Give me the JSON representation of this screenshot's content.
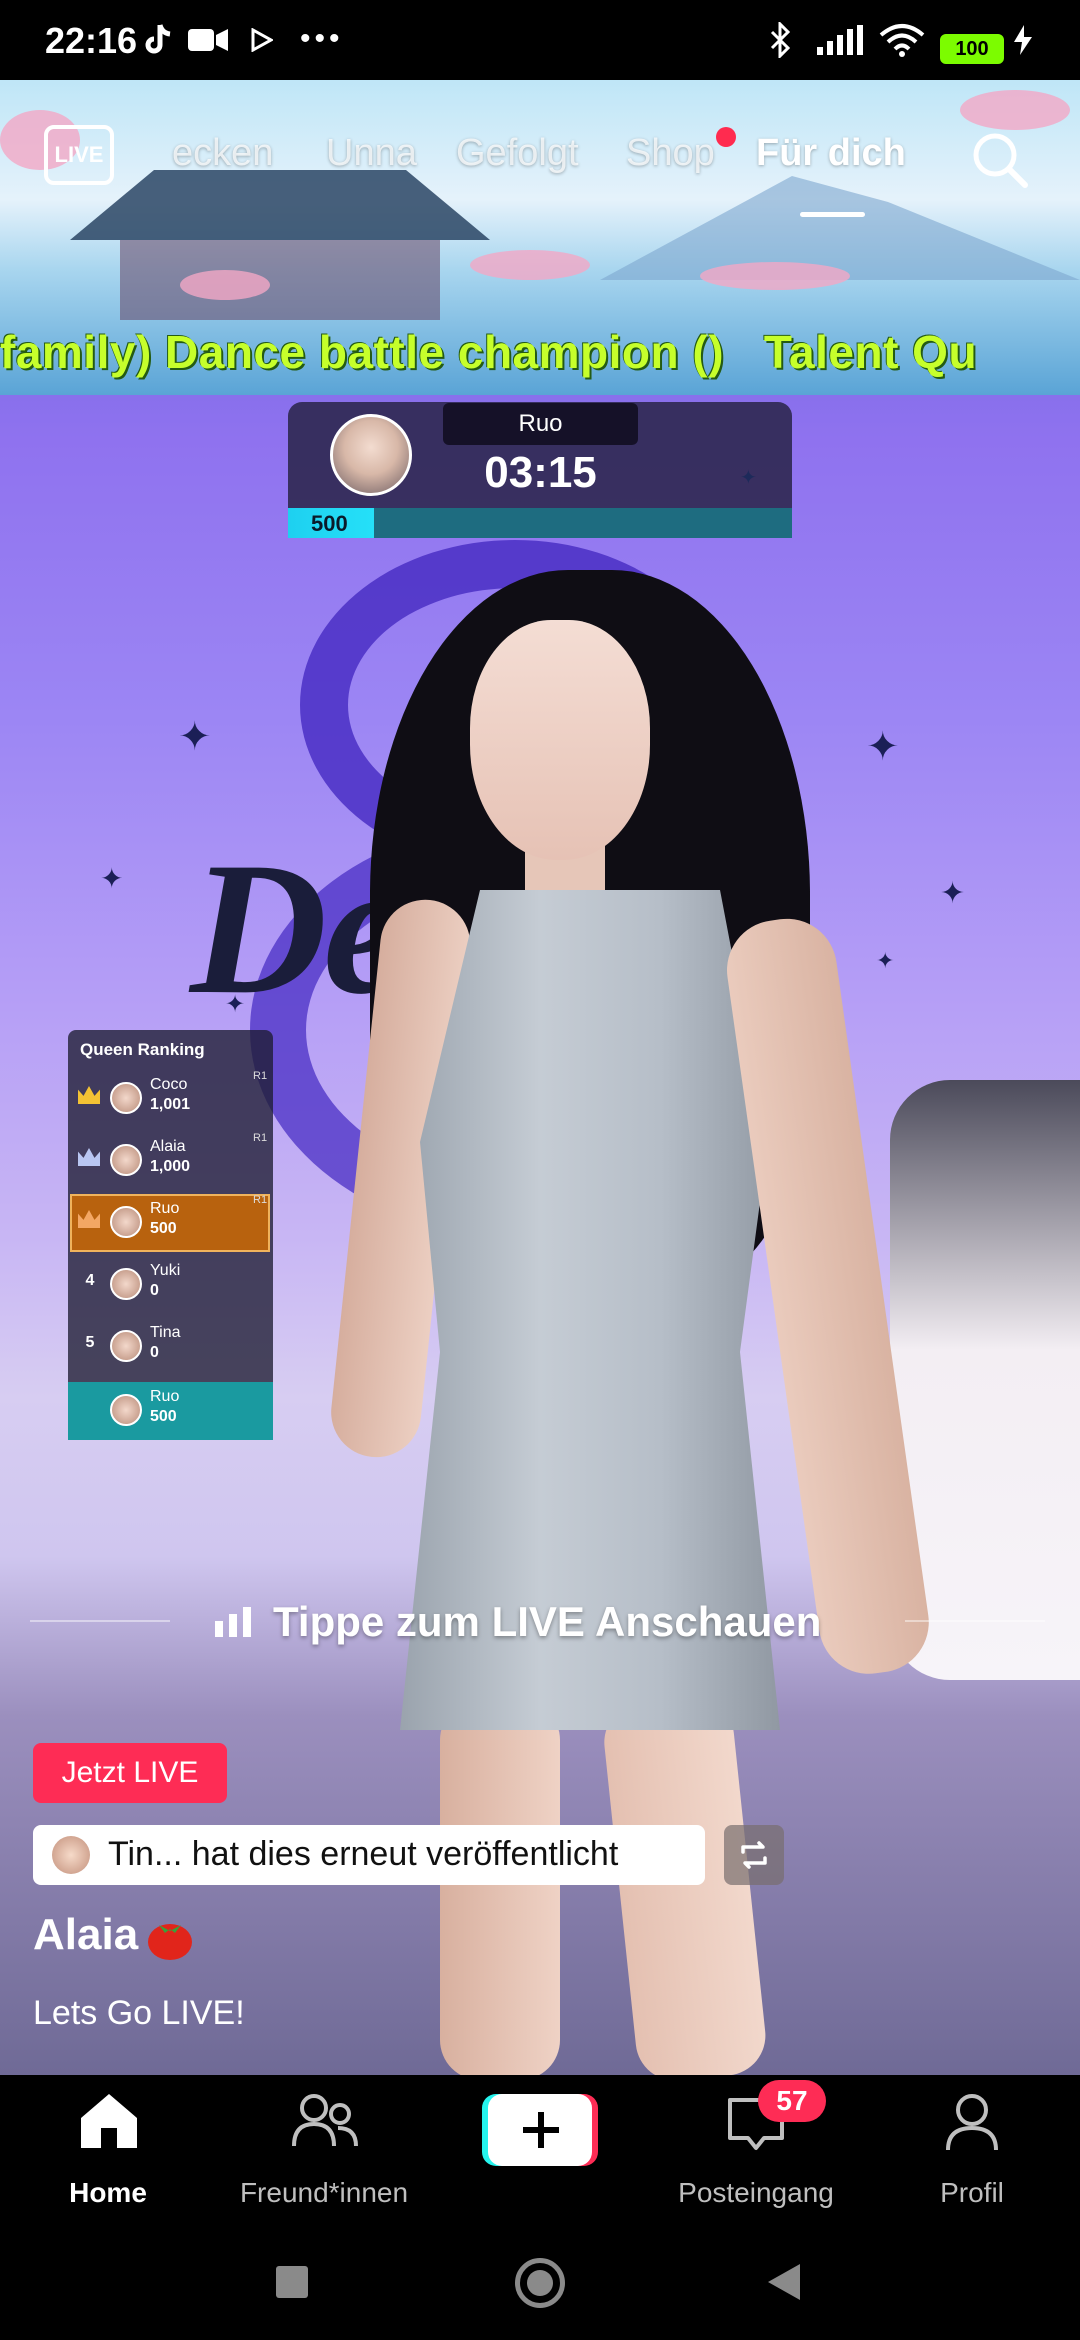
{
  "status_bar": {
    "time": "22:16",
    "battery": "100",
    "dots": "•••"
  },
  "top_nav": {
    "live_icon_label": "LIVE",
    "tabs": [
      {
        "label": "ecken"
      },
      {
        "label": "Unna"
      },
      {
        "label": "Gefolgt"
      },
      {
        "label": "Shop"
      },
      {
        "label": "Für dich"
      }
    ]
  },
  "ticker": {
    "text": "family) Dance battle champion ()   Talent Qu"
  },
  "battle_timer": {
    "name": "Ruo",
    "time": "03:15",
    "score": "500",
    "progress": 0.17
  },
  "backdrop": {
    "logo_text": "De      u"
  },
  "ranking": {
    "title": "Queen Ranking",
    "rows": [
      {
        "rank": "1",
        "name": "Coco",
        "score": "1,001",
        "tag": "R1",
        "crown_color": "#f3c234"
      },
      {
        "rank": "2",
        "name": "Alaia",
        "score": "1,000",
        "tag": "R1",
        "crown_color": "#b9c6f2"
      },
      {
        "rank": "3",
        "name": "Ruo",
        "score": "500",
        "tag": "R1",
        "crown_color": "#f3a764"
      },
      {
        "rank": "4",
        "name": "Yuki",
        "score": "0",
        "tag": ""
      },
      {
        "rank": "5",
        "name": "Tina",
        "score": "0",
        "tag": ""
      }
    ],
    "self": {
      "name": "Ruo",
      "score": "500"
    }
  },
  "tap_to_watch": "Tippe zum LIVE Anschauen",
  "post": {
    "live_badge": "Jetzt LIVE",
    "repost_text": "Tin... hat dies erneut veröffentlicht",
    "username": "Alaia",
    "description": "Lets Go LIVE!"
  },
  "bottom_nav": {
    "items": [
      {
        "label": "Home",
        "icon": "home-icon"
      },
      {
        "label": "Freund*innen",
        "icon": "friends-icon"
      },
      {
        "label": "",
        "icon": "create-plus-icon"
      },
      {
        "label": "Posteingang",
        "icon": "inbox-icon"
      },
      {
        "label": "Profil",
        "icon": "profile-icon"
      }
    ],
    "inbox_badge": "57"
  },
  "colors": {
    "accent": "#fe2c55",
    "ticker": "#c6ff2b",
    "timer_bar": "#25e0f8"
  }
}
